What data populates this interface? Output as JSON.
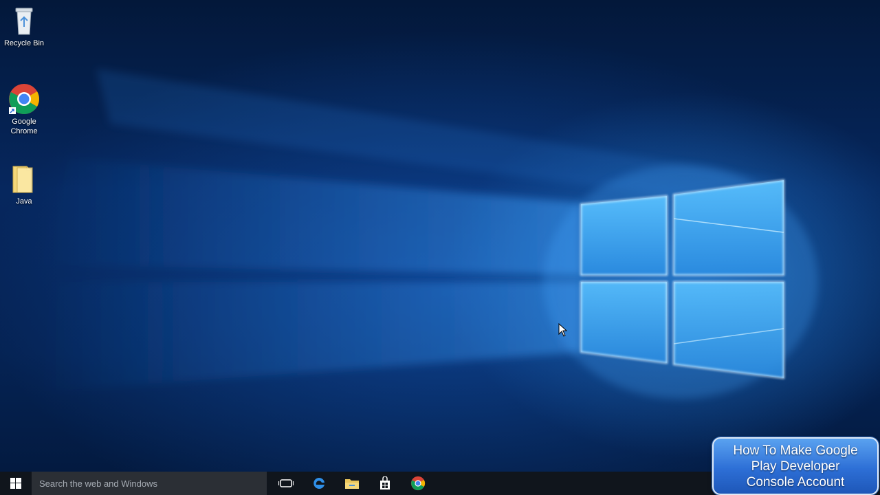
{
  "desktop": {
    "icons": [
      {
        "label_lines": [
          "Recycle Bin"
        ],
        "icon": "recycle-bin-icon"
      },
      {
        "label_lines": [
          "Google",
          "Chrome"
        ],
        "icon": "chrome-icon"
      },
      {
        "label_lines": [
          "Java"
        ],
        "icon": "folder-icon"
      }
    ]
  },
  "overlay": {
    "lines": [
      "How To Make Google",
      "Play Developer",
      "Console Account"
    ]
  },
  "taskbar": {
    "search_placeholder": "Search the web and Windows",
    "pinned": [
      "task-view-icon",
      "edge-icon",
      "file-explorer-icon",
      "store-icon",
      "chrome-icon"
    ]
  },
  "colors": {
    "wallpaper_dark": "#03183a",
    "wallpaper_glow": "#3aa0ff",
    "taskbar": "#10151c",
    "search_box": "#2b2f35",
    "badge_blue": "#2d6fd6"
  }
}
